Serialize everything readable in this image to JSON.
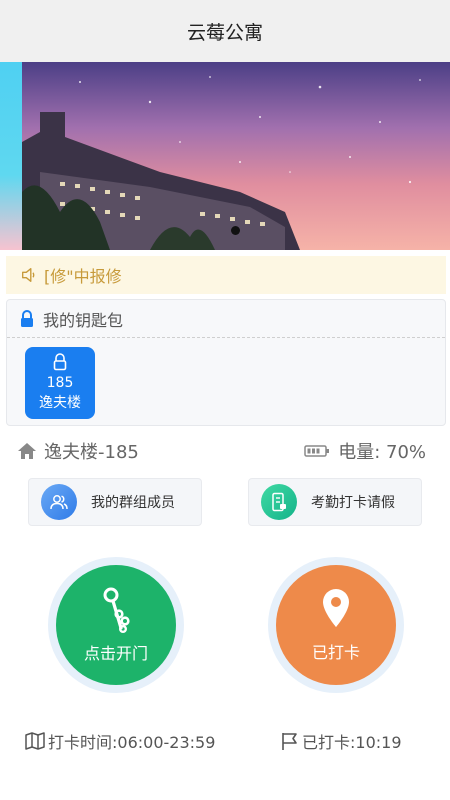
{
  "header": {
    "title": "云莓公寓"
  },
  "banner": {
    "image": "campus-building-night-sky",
    "indicator": "carousel-dot"
  },
  "notice": {
    "icon": "speaker-icon",
    "text": "[修\"中报修"
  },
  "keybag": {
    "title": "我的钥匙包",
    "icon": "lock-icon",
    "keys": [
      {
        "number": "185",
        "building": "逸夫楼"
      }
    ]
  },
  "info": {
    "room": "逸夫楼-185",
    "home_icon": "home-icon",
    "battery_icon": "battery-icon",
    "battery": "电量: 70%"
  },
  "actions": {
    "group_members": "我的群组成员",
    "attendance": "考勤打卡请假"
  },
  "main_buttons": {
    "open_door": "点击开门",
    "checked_in": "已打卡"
  },
  "footer": {
    "punch_time": "打卡时间:06:00-23:59",
    "checked_time": "已打卡:10:19"
  },
  "colors": {
    "primary_blue": "#1a7ef0",
    "green": "#1db36a",
    "orange": "#ee8a4a",
    "notice_text": "#c79a3a"
  }
}
